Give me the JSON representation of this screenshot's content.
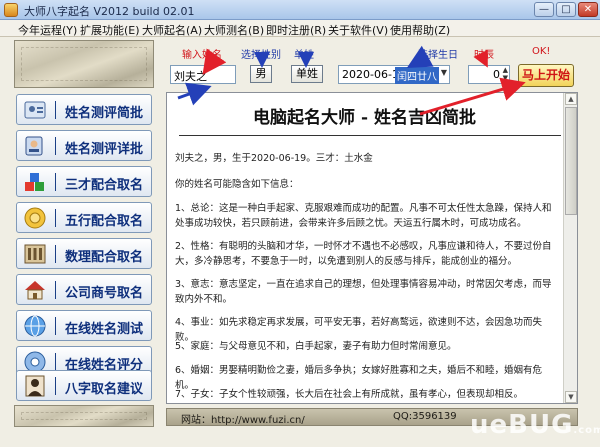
{
  "window": {
    "title": "大师八字起名 V2012 build 02.01",
    "min_label": "—",
    "max_label": "□",
    "close_label": "✕"
  },
  "menu": [
    "今年运程(Y)",
    "扩展功能(E)",
    "大师起名(A)",
    "大师测名(B)",
    "即时注册(R)",
    "关于软件(V)",
    "使用帮助(Z)"
  ],
  "nav": [
    {
      "label": "姓名测评简批",
      "icon": "person-card-icon"
    },
    {
      "label": "姓名测评详批",
      "icon": "id-card-icon"
    },
    {
      "label": "三才配合取名",
      "icon": "cubes-icon"
    },
    {
      "label": "五行配合取名",
      "icon": "coins-icon"
    },
    {
      "label": "数理配合取名",
      "icon": "abacus-icon"
    },
    {
      "label": "公司商号取名",
      "icon": "house-icon"
    },
    {
      "label": "在线姓名测试",
      "icon": "globe-icon"
    },
    {
      "label": "在线姓名评分",
      "icon": "disc-icon"
    },
    {
      "label": "八字取名建议",
      "icon": "portrait-icon"
    }
  ],
  "hints": {
    "name": "输入姓名",
    "gender": "选择性别",
    "single_surname": "单姓",
    "birthday": "选择生日",
    "hour": "时辰",
    "ok": "OK!"
  },
  "inputs": {
    "name_value": "刘夫之",
    "gender_value": "男",
    "surname_value": "单姓",
    "date_value": "2020-06-19",
    "lunar_value": "闰四廿八",
    "hour_value": "0",
    "start_label": "马上开始"
  },
  "doc": {
    "title": "电脑起名大师 - 姓名吉凶简批",
    "intro": "刘夫之，男，生于2020-06-19。三才：土水金",
    "lead": "你的姓名可能隐含如下信息：",
    "items": [
      "1、总论：这是一种白手起家、克服艰难而成功的配置。凡事不可太任性太急躁，保持人和处事成功较快，若只顾前进，会带来许多后顾之忧。天运五行属木时，可成功成名。",
      "2、性格：有聪明的头脑和才华，一时怀才不遇也不必感叹，凡事应谦和待人，不要过份自大，多冷静思考，不要急于一时，以免遭到别人的反感与排斥，能成创业的福分。",
      "3、意志：意志坚定，一直在追求自己的理想，但处理事情容易冲动，时常因欠考虑，而导致内外不和。",
      "4、事业：如先求稳定再求发展，可平安无事，若好高鹜远，欲速则不达，会因急功而失败。",
      "5、家庭：与父母意见不和，白手起家，妻子有助力但时常闹意见。",
      "6、婚姻：男娶精明勤俭之妻，婚后多争执；女嫁好胜寡和之夫，婚后不和睦，婚姻有危机。",
      "7、子女：子女个性较顽强，长大后在社会上有所成就，虽有孝心，但表现却相反。"
    ]
  },
  "footer": {
    "site": "网站：http://www.fuzi.cn/",
    "qq": "QQ:3596139"
  },
  "watermark": {
    "main": "ueBUG",
    "sub": ".com"
  },
  "colors": {
    "nav_text": "#0e2f7c",
    "hint_red": "#d2151b",
    "arrow_red": "#e2202a",
    "arrow_blue": "#2440b8"
  }
}
